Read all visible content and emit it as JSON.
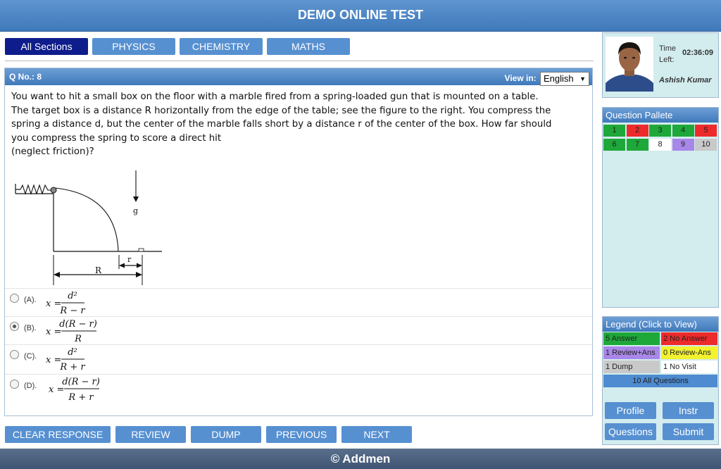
{
  "header": {
    "title": "DEMO ONLINE TEST"
  },
  "tabs": [
    {
      "label": "All Sections",
      "active": true
    },
    {
      "label": "PHYSICS",
      "active": false
    },
    {
      "label": "CHEMISTRY",
      "active": false
    },
    {
      "label": "MATHS",
      "active": false
    }
  ],
  "question": {
    "number_label": "Q No.: 8",
    "view_in_label": "View in:",
    "language": "English",
    "text": "You want to hit a small box on the floor with a marble fired from a spring-loaded gun that is mounted on a table. The target box is a distance R horizontally from the edge of the table; see the figure to the right. You compress the spring a distance d, but the center of the marble falls short by a distance r of the center of the box. How far should you compress the spring to score a direct hit",
    "text2": "(neglect friction)?",
    "figure": {
      "gravity_label": "g",
      "R_label": "R",
      "r_label": "r"
    }
  },
  "options": [
    {
      "label": "(A).",
      "lhs": "x =",
      "num": "d²",
      "den": "R − r",
      "selected": false
    },
    {
      "label": "(B).",
      "lhs": "x =",
      "num": "d(R − r)",
      "den": "R",
      "selected": true
    },
    {
      "label": "(C).",
      "lhs": "x =",
      "num": "d²",
      "den": "R + r",
      "selected": false
    },
    {
      "label": "(D).",
      "lhs": "x =",
      "num": "d(R − r)",
      "den": "R + r",
      "selected": false
    }
  ],
  "buttons": {
    "clear": "CLEAR RESPONSE",
    "review": "REVIEW",
    "dump": "DUMP",
    "previous": "PREVIOUS",
    "next": "NEXT"
  },
  "footer": {
    "text": "© Addmen"
  },
  "profile": {
    "time_left_label": "Time Left:",
    "time_left": "02:36:09",
    "name": "Ashish Kumar"
  },
  "palette": {
    "title": "Question Pallete",
    "cells": [
      {
        "n": "1",
        "color": "#1fa83a"
      },
      {
        "n": "2",
        "color": "#ee2b2b"
      },
      {
        "n": "3",
        "color": "#1fa83a"
      },
      {
        "n": "4",
        "color": "#1fa83a"
      },
      {
        "n": "5",
        "color": "#ee2b2b"
      },
      {
        "n": "6",
        "color": "#1fa83a"
      },
      {
        "n": "7",
        "color": "#1fa83a"
      },
      {
        "n": "8",
        "color": "#ffffff"
      },
      {
        "n": "9",
        "color": "#a987e8"
      },
      {
        "n": "10",
        "color": "#c9c9c9"
      }
    ]
  },
  "legend": {
    "title": "Legend (Click to View)",
    "items": [
      {
        "text": "5 Answer",
        "color": "#1fa83a"
      },
      {
        "text": "2 No Answer",
        "color": "#ee2b2b"
      },
      {
        "text": "1 Review+Ans",
        "color": "#a987e8"
      },
      {
        "text": "0 Review-Ans",
        "color": "#f2f22e"
      },
      {
        "text": "1 Dump",
        "color": "#c9c9c9"
      },
      {
        "text": "1 No Visit",
        "color": "#ffffff"
      }
    ],
    "all": "10 All Questions"
  },
  "side_buttons": {
    "profile": "Profile",
    "instr": "Instr",
    "questions": "Questions",
    "submit": "Submit"
  }
}
